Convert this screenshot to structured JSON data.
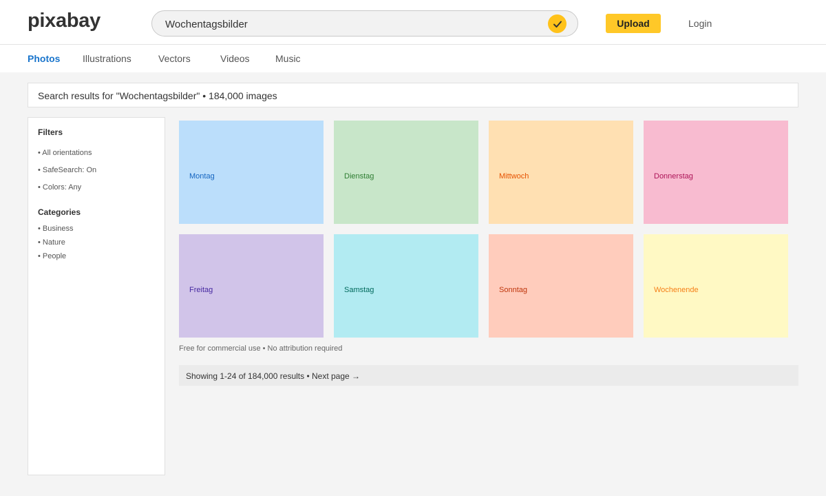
{
  "header": {
    "logo": "pixabay",
    "search_value": "Wochentagsbilder",
    "search_icon": "check-icon",
    "upload_label": "Upload",
    "login_label": "Login"
  },
  "nav": {
    "tabs": [
      {
        "label": "Photos",
        "active": true
      },
      {
        "label": "Illustrations",
        "active": false
      },
      {
        "label": "Vectors",
        "active": false
      },
      {
        "label": "Videos",
        "active": false
      },
      {
        "label": "Music",
        "active": false
      }
    ]
  },
  "results": {
    "summary": "Search results for \"Wochentagsbilder\" • 184,000 images"
  },
  "sidebar": {
    "filters_heading": "Filters",
    "filters": [
      "• All orientations",
      "• SafeSearch: On",
      "• Colors: Any"
    ],
    "categories_heading": "Categories",
    "categories": [
      "• Business",
      "• Nature",
      "• People"
    ]
  },
  "grid": {
    "tiles": [
      {
        "label": "Montag",
        "bg": "#bbdefb",
        "fg": "#1565c0"
      },
      {
        "label": "Dienstag",
        "bg": "#c8e6c9",
        "fg": "#2e7d32"
      },
      {
        "label": "Mittwoch",
        "bg": "#ffe0b2",
        "fg": "#e65100"
      },
      {
        "label": "Donnerstag",
        "bg": "#f8bbd0",
        "fg": "#ad1457"
      },
      {
        "label": "Freitag",
        "bg": "#d1c4e9",
        "fg": "#4527a0"
      },
      {
        "label": "Samstag",
        "bg": "#b2ebf2",
        "fg": "#00695c"
      },
      {
        "label": "Sonntag",
        "bg": "#ffccbc",
        "fg": "#bf360c"
      },
      {
        "label": "Wochenende",
        "bg": "#fff9c4",
        "fg": "#f57f17"
      }
    ]
  },
  "footer": {
    "license": "Free for commercial use • No attribution required",
    "pager": "Showing 1-24 of 184,000 results • Next page →"
  },
  "colors": {
    "accent": "#ffc828",
    "active_tab": "#1a75cc"
  }
}
